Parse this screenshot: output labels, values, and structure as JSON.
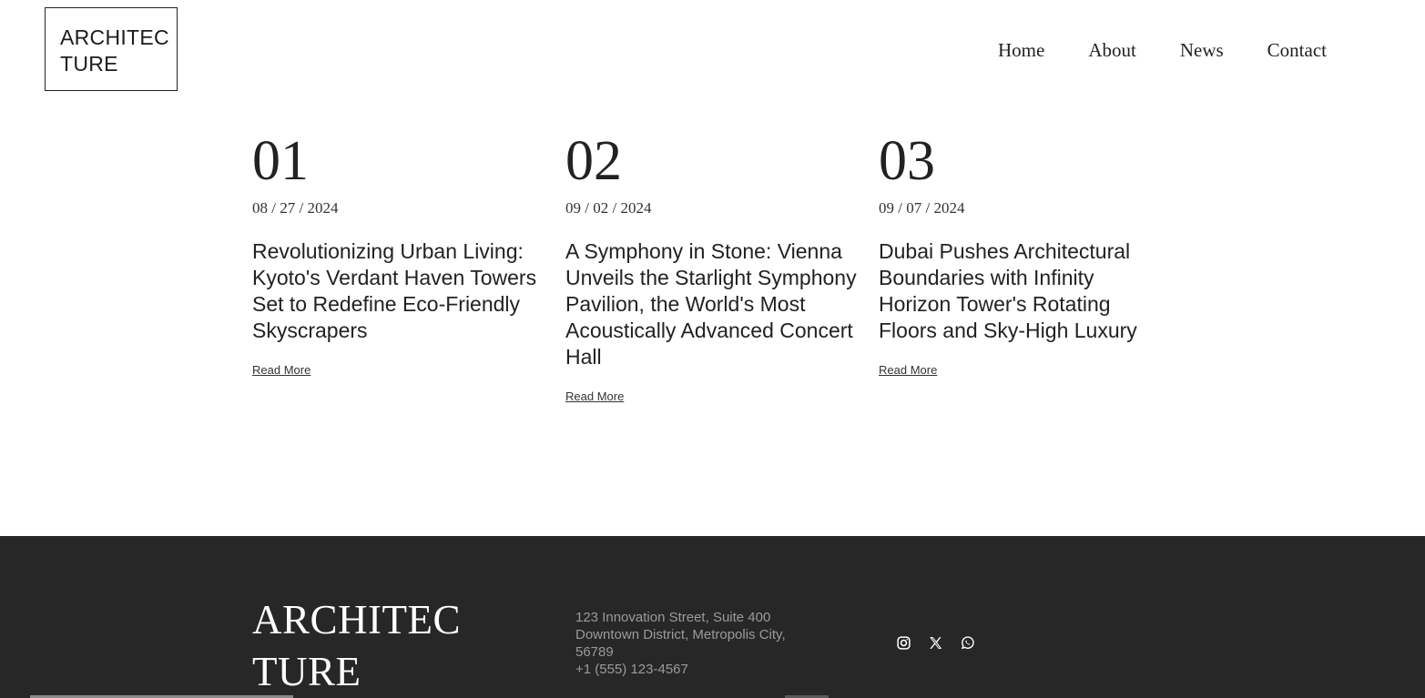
{
  "header": {
    "logo_line1": "ARCHITEC",
    "logo_line2": "TURE",
    "nav": {
      "home": "Home",
      "about": "About",
      "news": "News",
      "contact": "Contact"
    }
  },
  "news": {
    "items": [
      {
        "number": "01",
        "date": "08 / 27 / 2024",
        "title": "Revolutionizing Urban Living: Kyoto's Verdant Haven Towers Set to Redefine Eco-Friendly Skyscrapers",
        "link": "Read More"
      },
      {
        "number": "02",
        "date": "09 / 02 / 2024",
        "title": "A Symphony in Stone: Vienna Unveils the Starlight Symphony Pavilion, the World's Most Acoustically Advanced Concert Hall",
        "link": "Read More"
      },
      {
        "number": "03",
        "date": "09 / 07 / 2024",
        "title": "Dubai Pushes Architectural Boundaries with Infinity Horizon Tower's Rotating Floors and Sky-High Luxury",
        "link": "Read More"
      }
    ]
  },
  "footer": {
    "logo_line1": "ARCHITEC",
    "logo_line2": "TURE",
    "address_line1": "123 Innovation Street, Suite 400",
    "address_line2": "Downtown District, Metropolis City,",
    "address_line3": "56789",
    "phone": "+1 (555) 123-4567",
    "socials": [
      "instagram-icon",
      "x-icon",
      "whatsapp-icon"
    ],
    "background": "#272727"
  }
}
